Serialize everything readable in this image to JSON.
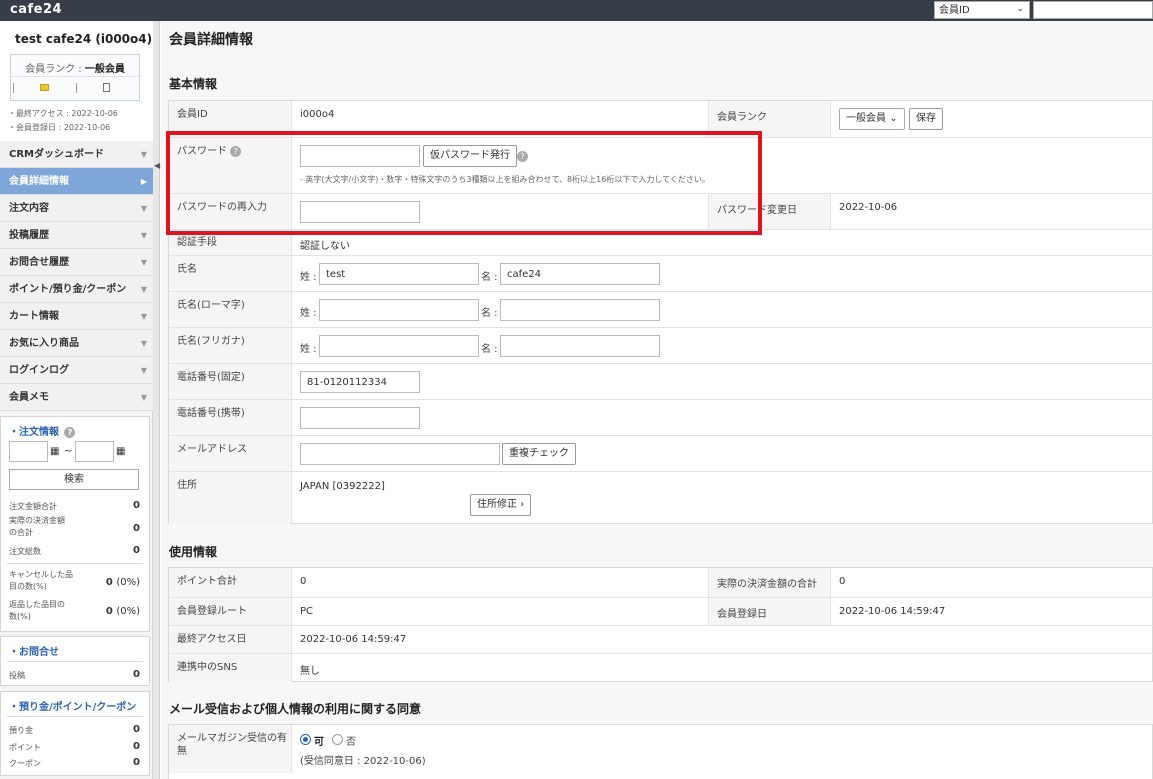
{
  "app": {
    "logo": "cafe24"
  },
  "topbar": {
    "search_select": "会員ID",
    "search_value": ""
  },
  "profile": {
    "name": "test cafe24 (i000o4)",
    "rank_prefix": "会員ランク : ",
    "rank_value": "一般会員",
    "last_access": "・最終アクセス : 2022-10-06",
    "join_date": "・会員登録日 : 2022-10-06"
  },
  "nav": {
    "items": [
      {
        "label": "CRMダッシュボード",
        "active": false
      },
      {
        "label": "会員詳細情報",
        "active": true
      },
      {
        "label": "注文内容",
        "active": false
      },
      {
        "label": "投稿履歴",
        "active": false
      },
      {
        "label": "お問合せ履歴",
        "active": false
      },
      {
        "label": "ポイント/預り金/クーポン",
        "active": false
      },
      {
        "label": "カート情報",
        "active": false
      },
      {
        "label": "お気に入り商品",
        "active": false
      },
      {
        "label": "ログインログ",
        "active": false
      },
      {
        "label": "会員メモ",
        "active": false
      }
    ]
  },
  "order_box": {
    "title": "注文情報",
    "date_sep": "~",
    "search_label": "検索",
    "stats": [
      {
        "label": "注文金額合計",
        "value": "0",
        "pct": ""
      },
      {
        "label": "実際の決済金額の合計",
        "value": "0",
        "pct": ""
      },
      {
        "label": "注文総数",
        "value": "0",
        "pct": ""
      },
      {
        "label": "キャンセルした品目の数(%)",
        "value": "0",
        "pct": "(0%)"
      },
      {
        "label": "返品した品目の数(%)",
        "value": "0",
        "pct": "(0%)"
      }
    ]
  },
  "inquiry_box": {
    "title": "お問合せ",
    "label": "投稿",
    "value": "0"
  },
  "points_box": {
    "title": "預り金/ポイント/クーポン",
    "rows": [
      {
        "label": "預り金",
        "value": "0"
      },
      {
        "label": "ポイント",
        "value": "0"
      },
      {
        "label": "クーポン",
        "value": "0"
      }
    ]
  },
  "main": {
    "title": "会員詳細情報",
    "basic_title": "基本情報",
    "member_id_label": "会員ID",
    "member_id": "i000o4",
    "rank_label": "会員ランク",
    "rank_select": "一般会員",
    "save_label": "保存",
    "password_label": "パスワード",
    "temp_password_label": "仮パスワード発行",
    "password_note": "- 英字(大文字/小文字)・数字・特殊文字のうち3種類以上を組み合わせて、8桁以上16桁以下で入力してください。",
    "password_confirm_label": "パスワードの再入力",
    "password_changed_label": "パスワード変更日",
    "password_changed_date": "2022-10-06",
    "auth_label": "認証手段",
    "auth_value": "認証しない",
    "name_label": "氏名",
    "last_name_prefix": "姓 :",
    "first_name_prefix": "名 :",
    "last_name": "test",
    "first_name": "cafe24",
    "roman_label": "氏名(ローマ字)",
    "kana_label": "氏名(フリガナ)",
    "phone_label": "電話番号(固定)",
    "phone_value": "81-0120112334",
    "mobile_label": "電話番号(携帯)",
    "email_label": "メールアドレス",
    "dup_check_label": "重複チェック",
    "address_label": "住所",
    "address_value": "JAPAN [0392222]",
    "address_edit_label": "住所修正 ›",
    "usage_title": "使用情報",
    "points_total_label": "ポイント合計",
    "points_total": "0",
    "actual_pay_label": "実際の決済金額の合計",
    "actual_pay": "0",
    "route_label": "会員登録ルート",
    "route_value": "PC",
    "join_date_label": "会員登録日",
    "join_date": "2022-10-06 14:59:47",
    "last_access_label": "最終アクセス日",
    "last_access": "2022-10-06 14:59:47",
    "sns_label": "連携中のSNS",
    "sns_value": "無し",
    "consent_title": "メール受信および個人情報の利用に関する同意",
    "magazine_label": "メールマガジン受信の有無",
    "radio_yes": "可",
    "radio_no": "否",
    "consent_date": "(受信同意日 : 2022-10-06)"
  },
  "colors": {
    "highlight": "#e0141e",
    "accent": "#2a63b3",
    "nav_active": "#7fa6d9",
    "topbar": "#373d49"
  }
}
